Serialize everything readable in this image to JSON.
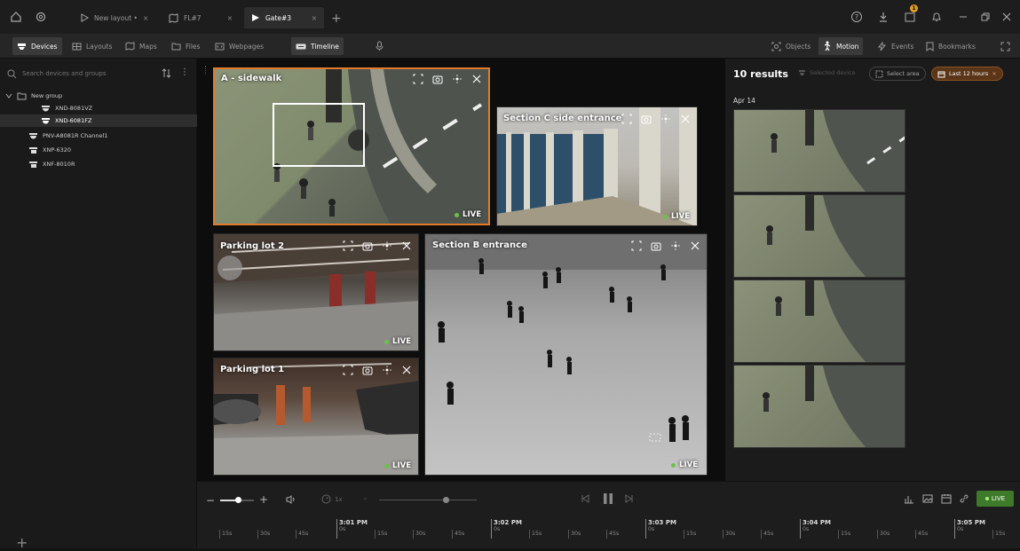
{
  "tabs": [
    {
      "label": "New layout •"
    },
    {
      "label": "FL#7"
    },
    {
      "label": "Gate#3"
    }
  ],
  "title_badge": "1",
  "toolbar": {
    "devices": "Devices",
    "layouts": "Layouts",
    "maps": "Maps",
    "files": "Files",
    "webpages": "Webpages",
    "timeline": "Timeline",
    "objects": "Objects",
    "motion": "Motion",
    "events": "Events",
    "bookmarks": "Bookmarks"
  },
  "sidebar": {
    "search_placeholder": "Search devices and groups",
    "group": "New group",
    "devices": [
      {
        "label": "XND-8081VZ"
      },
      {
        "label": "XND-6081FZ"
      },
      {
        "label": "PNV-A8081R Channel1"
      },
      {
        "label": "XNP-6320"
      },
      {
        "label": "XNF-8010R"
      }
    ]
  },
  "cameras": [
    {
      "title": "A - sidewalk",
      "status": "LIVE"
    },
    {
      "title": "Section C side entrance",
      "status": "LIVE"
    },
    {
      "title": "Parking lot 2",
      "status": "LIVE"
    },
    {
      "title": "Section B entrance",
      "status": "LIVE"
    },
    {
      "title": "Parking lot 1",
      "status": "LIVE"
    }
  ],
  "results": {
    "count": "10 results",
    "selected_device": "Selected device",
    "select_area": "Select area",
    "range": "Last 12 hours",
    "date": "Apr 14"
  },
  "playback": {
    "speed": "1x",
    "live": "LIVE"
  },
  "timeline": {
    "major": [
      "3:01 PM",
      "3:02 PM",
      "3:03 PM",
      "3:04 PM",
      "3:05 PM"
    ],
    "ticks": [
      "15s",
      "30s",
      "45s",
      "0s",
      "15s",
      "30s",
      "45s",
      "0s",
      "15s",
      "30s",
      "45s",
      "0s",
      "15s",
      "30s",
      "45s",
      "0s",
      "15s",
      "30s",
      "45s",
      "0s",
      "15s"
    ]
  },
  "colors": {
    "accent": "#e07b2c",
    "live": "#6cc04a",
    "range_bg": "#5a3518"
  }
}
